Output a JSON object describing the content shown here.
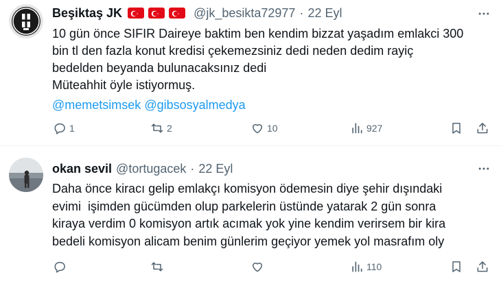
{
  "tweets": [
    {
      "name": "Beşiktaş JK",
      "flags": [
        "tr-flag",
        "tr-flag",
        "tr-flag"
      ],
      "handle": "@jk_besikta72977",
      "separator": "·",
      "date": "22 Eyl",
      "body_lines": [
        "10 gün önce SIFIR Daireye baktim ben kendim bizzat yaşadım emlakci 300",
        "bin tl den fazla konut kredisi çekemezsiniz dedi neden dedim rayiç",
        "bedelden beyanda bulunacaksınız dedi",
        "Müteahhit öyle istiyormuş."
      ],
      "mentions": [
        "@memetsimsek",
        "@gibsosyalmedya"
      ],
      "replies": "1",
      "retweets": "2",
      "likes": "10",
      "views": "927"
    },
    {
      "name": "okan sevil",
      "handle": "@tortugacek",
      "separator": "·",
      "date": "22 Eyl",
      "body_lines": [
        "Daha önce kiracı gelip emlakçı komisyon ödemesin diye şehir dışındaki",
        "evimi  işimden gücümden olup parkelerin üstünde yatarak 2 gün sonra",
        "kiraya verdim 0 komisyon artık acımak yok yine kendim verirsem bir kira",
        "bedeli komisyon alicam benim günlerim geçiyor yemek yol masrafım oly"
      ],
      "replies": "",
      "retweets": "",
      "likes": "",
      "views": "110"
    }
  ],
  "colors": {
    "text": "#0f1419",
    "muted": "#536471",
    "link": "#1d9bf0",
    "flag_red": "#e30a17",
    "divider": "#eff3f4"
  }
}
